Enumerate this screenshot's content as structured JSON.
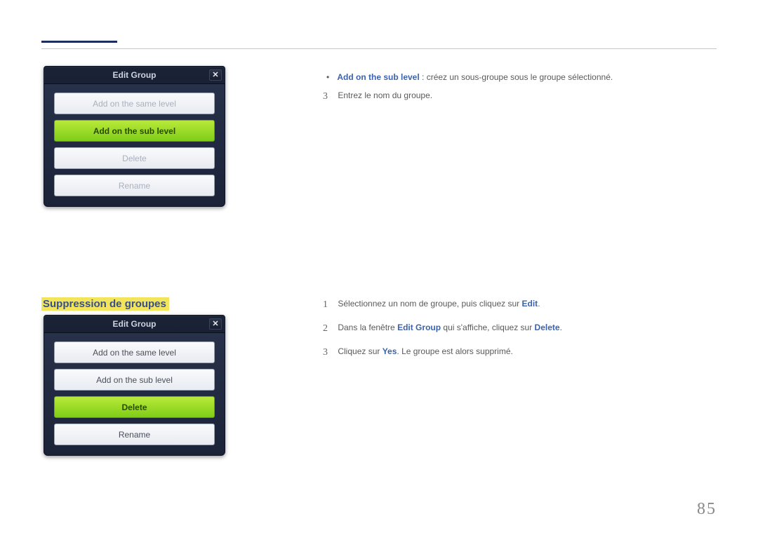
{
  "page_number": "85",
  "dialog1": {
    "title": "Edit Group",
    "options": {
      "same": "Add on the same level",
      "sub": "Add on the sub level",
      "delete": "Delete",
      "rename": "Rename"
    }
  },
  "dialog2": {
    "title": "Edit Group",
    "options": {
      "same": "Add on the same level",
      "sub": "Add on the sub level",
      "delete": "Delete",
      "rename": "Rename"
    }
  },
  "section_heading": "Suppression de groupes",
  "bullet": {
    "label": "Add on the sub level",
    "rest": " : créez un sous-groupe sous le groupe sélectionné."
  },
  "steps_top": {
    "n3": "3",
    "t3": "Entrez le nom du groupe."
  },
  "steps": {
    "n1": "1",
    "t1_a": "Sélectionnez un nom de groupe, puis cliquez sur ",
    "t1_b": "Edit",
    "t1_c": ".",
    "n2": "2",
    "t2_a": "Dans la fenêtre ",
    "t2_b": "Edit Group",
    "t2_c": " qui s'affiche, cliquez sur ",
    "t2_d": "Delete",
    "t2_e": ".",
    "n3": "3",
    "t3_a": "Cliquez sur ",
    "t3_b": "Yes",
    "t3_c": ". Le groupe est alors supprimé."
  }
}
